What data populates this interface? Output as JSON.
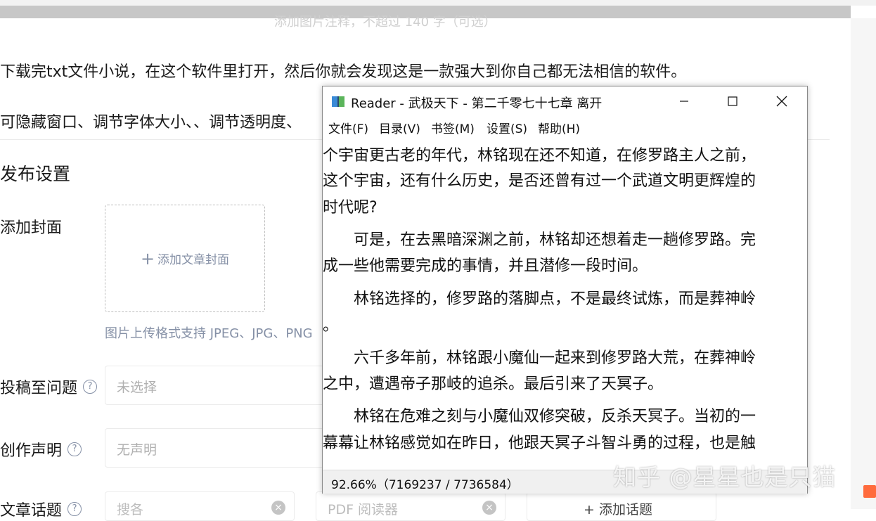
{
  "editor": {
    "faded_caption": "添加图片注释，不超过 140 字（可选）",
    "paragraph_1": "下载完txt文件小说，在这个软件里打开，然后你就会发现这是一款强大到你自己都无法相信的软件。",
    "paragraph_2": "可隐藏窗口、调节字体大小、、调节透明度、",
    "section_title": "发布设置",
    "cover_label": "添加封面",
    "cover_button": "添加文章封面",
    "upload_hint": "图片上传格式支持 JPEG、JPG、PNG",
    "submit_label": "投稿至问题",
    "submit_placeholder": "未选择",
    "declaration_label": "创作声明",
    "declaration_placeholder": "无声明",
    "topic_label": "文章话题",
    "topic_field_1": "搜各",
    "topic_field_2": "PDF 阅读器",
    "add_topic": "+ 添加话题"
  },
  "reader": {
    "title": "Reader - 武极天下 - 第二千零七十七章 离开",
    "menu": [
      "文件(F)",
      "目录(V)",
      "书签(M)",
      "设置(S)",
      "帮助(H)"
    ],
    "lines": [
      "个宇宙更古老的年代，林铭现在还不知道，在修罗路主人之前，",
      "这个宇宙，还有什么历史，是否还曾有过一个武道文明更辉煌的",
      "时代呢?",
      "　　可是，在去黑暗深渊之前，林铭却还想着走一趟修罗路。完",
      "成一些他需要完成的事情，并且潜修一段时间。",
      "　　林铭选择的，修罗路的落脚点，不是最终试炼，而是葬神岭",
      "。",
      "　　六千多年前，林铭跟小魔仙一起来到修罗路大荒，在葬神岭",
      "之中，遭遇帝子那岐的追杀。最后引来了天冥子。",
      "　　林铭在危难之刻与小魔仙双修突破，反杀天冥子。当初的一",
      "幕幕让林铭感觉如在昨日，他跟天冥子斗智斗勇的过程，也是触"
    ],
    "status": "92.66%（7169237 / 7736584）"
  },
  "watermark": "知乎 @星星也是只猫"
}
